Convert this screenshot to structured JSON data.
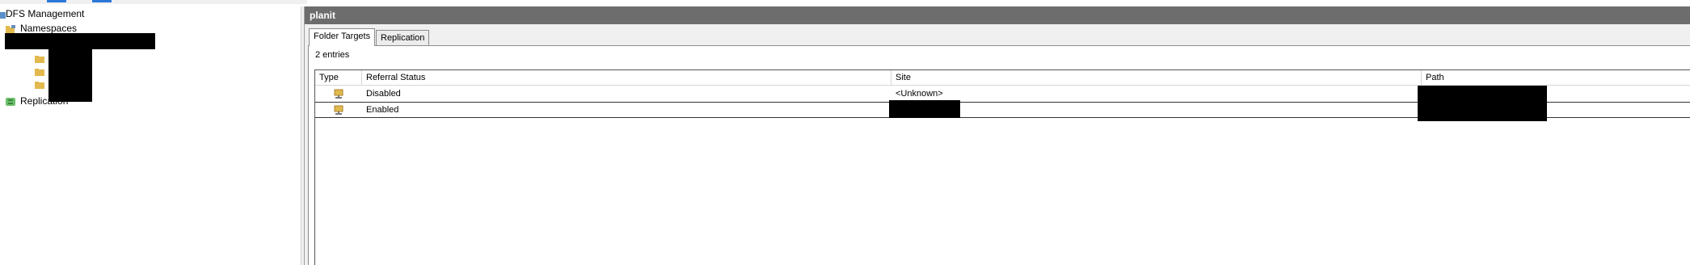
{
  "tree": {
    "root_label": "DFS Management",
    "namespaces_label": "Namespaces",
    "replication_label": "Replication"
  },
  "header": {
    "title": "planit"
  },
  "tabs": [
    {
      "label": "Folder Targets",
      "active": true
    },
    {
      "label": "Replication",
      "active": false
    }
  ],
  "entries_count": "2 entries",
  "columns": [
    "Type",
    "Referral Status",
    "Site",
    "Path"
  ],
  "rows": [
    {
      "icon": "folder-target-icon",
      "status": "Disabled",
      "site": "<Unknown>",
      "path": ""
    },
    {
      "icon": "folder-target-icon",
      "status": "Enabled",
      "site": "",
      "path": ""
    }
  ],
  "colors": {
    "header_bg": "#6d6d6d",
    "redaction": "#000000",
    "selection_blue": "#2b78d8"
  }
}
